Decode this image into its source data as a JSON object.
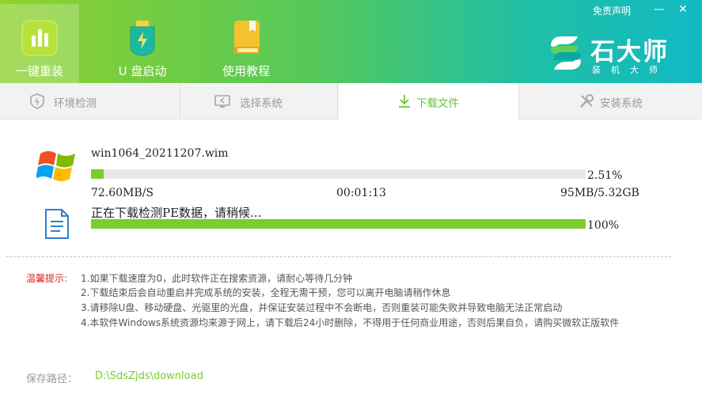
{
  "header": {
    "nav": [
      {
        "label": "一键重装",
        "icon": "bar-chart-icon"
      },
      {
        "label": "U 盘启动",
        "icon": "usb-drive-icon"
      },
      {
        "label": "使用教程",
        "icon": "book-icon"
      }
    ],
    "disclaimer": "免责声明",
    "minimize": "—",
    "close": "✕",
    "brand": {
      "name": "石大师",
      "subtitle": "装机大师"
    }
  },
  "steps": [
    {
      "label": "环境检测",
      "icon": "shield-icon"
    },
    {
      "label": "选择系统",
      "icon": "monitor-icon"
    },
    {
      "label": "下载文件",
      "icon": "download-icon"
    },
    {
      "label": "安装系统",
      "icon": "tools-icon"
    }
  ],
  "download": {
    "file_name": "win1064_20211207.wim",
    "file_progress": 2.51,
    "file_percent": "2.51%",
    "speed": "72.60MB/S",
    "elapsed": "00:01:13",
    "size": "95MB/5.32GB",
    "status": "正在下载检测PE数据，请稍候...",
    "status_progress": 100,
    "status_percent": "100%"
  },
  "tips": {
    "label": "温馨提示:",
    "items": [
      "1.如果下载速度为0，此时软件正在搜索资源，请耐心等待几分钟",
      "2.下载结束后会自动重启并完成系统的安装，全程无需干预，您可以离开电脑请稍作休息",
      "3.请移除U盘、移动硬盘、光驱里的光盘，并保证安装过程中不会断电，否则重装可能失败并导致电脑无法正常启动",
      "4.本软件Windows系统资源均来源于网上，请下载后24小时删除，不得用于任何商业用途，否则后果自负，请购买微软正版软件"
    ]
  },
  "save_path": {
    "label": "保存路径：",
    "value": "D:\\SdsZjds\\download"
  },
  "colors": {
    "accent": "#7ace2c",
    "warning": "#e02020",
    "track": "#e8e8e8"
  }
}
